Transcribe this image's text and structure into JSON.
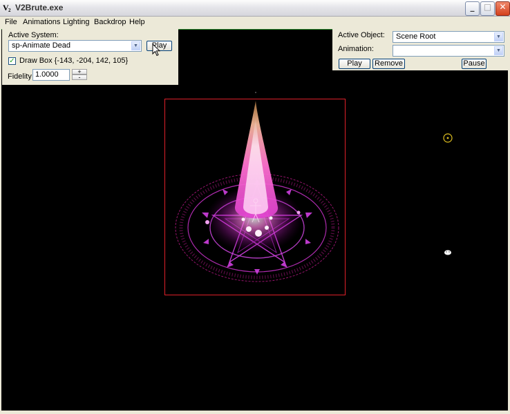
{
  "window": {
    "title": "V2Brute.exe",
    "icon_text": "V",
    "icon_subtext": "2",
    "controls": {
      "minimize": "_",
      "maximize": "□",
      "close": "✕"
    }
  },
  "menu": [
    "File",
    "Animations",
    "Lighting",
    "Backdrop",
    "Help"
  ],
  "left_panel": {
    "active_system_label": "Active System:",
    "active_system_value": "sp-Animate Dead",
    "play_label": "Play",
    "draw_box_checked": true,
    "draw_box_label": "Draw Box {-143, -204, 142, 105}",
    "fidelity_label": "Fidelity",
    "fidelity_value": "1.0000",
    "spin_up": "+",
    "spin_down": "-"
  },
  "right_panel": {
    "active_object_label": "Active Object:",
    "active_object_value": "Scene Root",
    "animation_label": "Animation:",
    "animation_value": "",
    "play_label": "Play",
    "remove_label": "Remove",
    "pause_label": "Pause"
  },
  "icons": {
    "dropdown_arrow": "▼",
    "check": "✓"
  },
  "colors": {
    "viewport_bg": "#000000",
    "bounding_box": "#e0202a",
    "effect_core": "#ff6ed0",
    "effect_glow": "#c020c0",
    "light_marker": "#e0c020"
  }
}
